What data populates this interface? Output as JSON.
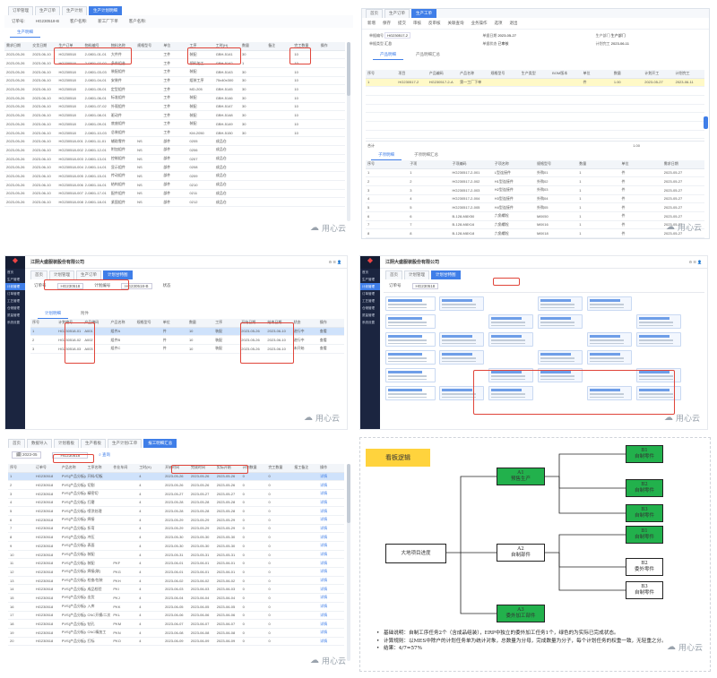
{
  "brand_watermark": "用心云",
  "company_name": "江阴大盛服装股份有限公司",
  "panel1": {
    "tabs": [
      "订单管理",
      "生产订单",
      "生产计划",
      "生产计划明细"
    ],
    "form": {
      "order_label": "订单号:",
      "order_value": "HG230518-B",
      "customer_label": "客户名称:",
      "customer_value": "新工厂下单",
      "product_label": "客户名称:"
    },
    "subtab": "生产明细",
    "columns": [
      "需求日期",
      "交货日期",
      "生产订单",
      "物料编号",
      "物料名称",
      "规格型号",
      "单位",
      "工序",
      "工时(H)",
      "数量",
      "备注",
      "完工数量",
      "操作"
    ],
    "rows": [
      [
        "2023-05-26",
        "2023-06-10",
        "HG230518",
        "2-0801-01-01",
        "大件件",
        "",
        "工件",
        "装配",
        "GBH-5141",
        "30",
        "",
        "10",
        ""
      ],
      [
        "2023-05-26",
        "2023-06-10",
        "HG230518",
        "2-0801-02-02",
        "多件组合",
        "",
        "工件",
        "领料加工",
        "GBH-5142",
        "1",
        "",
        "10",
        ""
      ],
      [
        "2023-05-26",
        "2023-06-10",
        "HG230518",
        "2-0801-03-03",
        "装配组件",
        "",
        "工件",
        "装配",
        "GBH-5143",
        "30",
        "",
        "10",
        ""
      ],
      [
        "2023-05-26",
        "2023-06-10",
        "HG230518",
        "2-0801-04-01",
        "安装件",
        "",
        "工件",
        "组装工序",
        "75x40x300",
        "30",
        "",
        "10",
        ""
      ],
      [
        "2023-05-26",
        "2023-06-10",
        "HG230518",
        "2-0801-05-01",
        "定型组件",
        "",
        "工件",
        "MD-205",
        "GBH-5145",
        "30",
        "",
        "10",
        ""
      ],
      [
        "2023-05-26",
        "2023-06-10",
        "HG230518",
        "2-0801-06-01",
        "标准组件",
        "",
        "工件",
        "装配",
        "GBH-5146",
        "30",
        "",
        "10",
        ""
      ],
      [
        "2023-05-26",
        "2023-06-10",
        "HG230518",
        "2-0801-07-02",
        "外观组件",
        "",
        "工件",
        "装配",
        "GBH-5147",
        "30",
        "",
        "10",
        ""
      ],
      [
        "2023-05-26",
        "2023-06-10",
        "HG230518",
        "2-0801-08-01",
        "驱动件",
        "",
        "工件",
        "装配",
        "GBH-5148",
        "30",
        "",
        "10",
        ""
      ],
      [
        "2023-05-26",
        "2023-06-10",
        "HG230518",
        "2-0801-09-01",
        "底座组件",
        "",
        "工件",
        "装配",
        "GBH-5149",
        "30",
        "",
        "10",
        ""
      ],
      [
        "2023-05-26",
        "2023-06-10",
        "HG230518",
        "2-0801-10-03",
        "总装组件",
        "",
        "工件",
        "KM-2050",
        "GBH-5150",
        "30",
        "",
        "10",
        ""
      ],
      [
        "2023-05-26",
        "2023-06-10",
        "HG230518-001",
        "2-0801-11-01",
        "辅助零件",
        "NS",
        "部件",
        "0205",
        "成品仓",
        "",
        "",
        "",
        ""
      ],
      [
        "2023-05-26",
        "2023-06-10",
        "HG230518-002",
        "2-0801-12-01",
        "附加组件",
        "NS",
        "部件",
        "0206",
        "成品仓",
        "",
        "",
        "",
        ""
      ],
      [
        "2023-05-26",
        "2023-06-10",
        "HG230518-003",
        "2-0801-13-01",
        "控制组件",
        "NS",
        "部件",
        "0207",
        "成品仓",
        "",
        "",
        "",
        ""
      ],
      [
        "2023-05-26",
        "2023-06-10",
        "HG230518-004",
        "2-0801-14-01",
        "显示组件",
        "NS",
        "部件",
        "0208",
        "成品仓",
        "",
        "",
        "",
        ""
      ],
      [
        "2023-05-26",
        "2023-06-10",
        "HG230518-005",
        "2-0801-15-01",
        "传动组件",
        "NS",
        "部件",
        "0209",
        "成品仓",
        "",
        "",
        "",
        ""
      ],
      [
        "2023-05-26",
        "2023-06-10",
        "HG230518-006",
        "2-0801-16-01",
        "结构组件",
        "NS",
        "部件",
        "0210",
        "成品仓",
        "",
        "",
        "",
        ""
      ],
      [
        "2023-05-26",
        "2023-06-10",
        "HG230518-007",
        "2-0801-17-01",
        "配件组件",
        "NS",
        "部件",
        "0211",
        "成品仓",
        "",
        "",
        "",
        ""
      ],
      [
        "2023-05-26",
        "2023-06-10",
        "HG230518-008",
        "2-0801-18-01",
        "紧固组件",
        "NS",
        "部件",
        "0212",
        "成品仓",
        "",
        "",
        "",
        ""
      ]
    ]
  },
  "panel2": {
    "menu": [
      "新增",
      "保存",
      "提交",
      "审核",
      "反审核",
      "关联查询",
      "业务操作",
      "选项",
      "退出"
    ],
    "tabs": [
      "首页",
      "生产订单",
      "生产工单"
    ],
    "form": {
      "no_label": "单据编号",
      "no_value": "HG230517-2",
      "date_label": "单据日期",
      "date_value": "2023-05-27",
      "type_label": "单据类型",
      "type_value": "汇总",
      "dept_label": "生产部门",
      "dept_value": "生产部门",
      "status_label": "单据状态",
      "status_value": "已审核",
      "finish_label": "计划完工",
      "finish_value": "2023-06-11"
    },
    "subtabs": [
      "产品明细",
      "产品明细汇总"
    ],
    "columns": [
      "序号",
      "项目",
      "产品编码",
      "产品名称",
      "规格型号",
      "生产类型",
      "BOM版本",
      "单位",
      "数量",
      "计划开工",
      "计划完工"
    ],
    "hl_row": [
      "1",
      "HG230517-2",
      "HG230517-2-A",
      "第一工厂下单",
      "",
      "",
      "",
      "件",
      "1.00",
      "2023-05-27",
      "2023-06-11"
    ],
    "total_label": "合计",
    "total_value": "1.00",
    "lower_tabs": [
      "子项明细",
      "子项明细汇总"
    ],
    "lower_columns": [
      "序号",
      "子项",
      "子项编码",
      "子项名称",
      "规格型号",
      "数量",
      "单位",
      "需求日期"
    ],
    "lower_rows": [
      [
        "1",
        "1",
        "HG230517-2-001",
        "L型连接件",
        "外购01",
        "1",
        "件",
        "2023-05-27"
      ],
      [
        "2",
        "2",
        "HG230517-2-002",
        "H1型连接件",
        "外购02",
        "1",
        "件",
        "2023-05-27"
      ],
      [
        "3",
        "3",
        "HG230517-2-003",
        "H2型连接件",
        "外购03",
        "1",
        "件",
        "2023-05-27"
      ],
      [
        "4",
        "4",
        "HG230517-2-004",
        "H3型连接件",
        "外购04",
        "1",
        "件",
        "2023-05-27"
      ],
      [
        "5",
        "5",
        "HG230517-2-005",
        "H4型连接件",
        "外购05",
        "1",
        "件",
        "2023-05-27"
      ],
      [
        "6",
        "6",
        "B-128-M8X50",
        "六角螺栓",
        "M8X50",
        "1",
        "件",
        "2023-05-27"
      ],
      [
        "7",
        "7",
        "B-128-M8X16",
        "六角螺栓",
        "M8X16",
        "1",
        "件",
        "2023-05-27"
      ],
      [
        "8",
        "8",
        "B-128-M8X18",
        "六角螺栓",
        "M8X18",
        "1",
        "件",
        "2023-05-27"
      ]
    ],
    "footer": "合计"
  },
  "panel3": {
    "sidebar": [
      "首页",
      "生产管理",
      "计划管理",
      "订单管理",
      "工艺管理",
      "仓储管理",
      "质量管理",
      "系统设置"
    ],
    "tabs": [
      "首页",
      "计划管理",
      "生产订单",
      "计划甘特图"
    ],
    "form": {
      "order_label": "订单号",
      "order_value": "HG230518",
      "plan_label": "计划编号",
      "plan_value": "HG230518-B",
      "status_label": "状态"
    },
    "subtabs": [
      "计划明细",
      "附件"
    ],
    "columns": [
      "序号",
      "计划编号",
      "产品编码",
      "产品名称",
      "规格型号",
      "单位",
      "数量",
      "工序",
      "开始日期",
      "结束日期",
      "状态",
      "操作"
    ],
    "rows": [
      [
        "1",
        "HG230518-01",
        "A001",
        "组件A",
        "",
        "件",
        "10",
        "装配",
        "2023-05-26",
        "2023-06-10",
        "进行中",
        "查看"
      ],
      [
        "2",
        "HG230518-02",
        "A002",
        "组件B",
        "",
        "件",
        "10",
        "装配",
        "2023-05-26",
        "2023-06-10",
        "进行中",
        "查看"
      ],
      [
        "3",
        "HG230518-03",
        "A003",
        "组件C",
        "",
        "件",
        "10",
        "装配",
        "2023-05-26",
        "2023-06-10",
        "未开始",
        "查看"
      ]
    ]
  },
  "panel4": {
    "tabs": [
      "首页",
      "计划管理",
      "计划甘特图"
    ],
    "filter_label": "订单号",
    "filter_value": "HG230518"
  },
  "panel5": {
    "tabs": [
      "首页",
      "数据导入",
      "计划看板",
      "生产看板",
      "生产计划/工单",
      "报工明细汇总"
    ],
    "filter_month": "2023-05",
    "filter_order": "HG230518",
    "search_label": "查询",
    "columns": [
      "序号",
      "订单号",
      "产品名称",
      "工序名称",
      "作业车间",
      "工时(H)",
      "开始时间",
      "完成时间",
      "实际开始",
      "计划数量",
      "完工数量",
      "报工备注",
      "操作"
    ],
    "rows": [
      [
        "1",
        "HG230518",
        "PVS(产品分板)(加工制作)",
        "开料/切板",
        "",
        "4",
        "2023-05-26",
        "2023-05-26",
        "2023-05-26",
        "0",
        "0",
        "",
        "详情"
      ],
      [
        "2",
        "HG230518",
        "PVS(产品分板)(加工制作)",
        "切割",
        "",
        "4",
        "2023-05-26",
        "2023-05-26",
        "2023-05-26",
        "0",
        "0",
        "",
        "详情"
      ],
      [
        "3",
        "HG230518",
        "PVS(产品分板)(加工制作)",
        "精密切",
        "",
        "4",
        "2023-05-27",
        "2023-05-27",
        "2023-05-27",
        "0",
        "0",
        "",
        "详情"
      ],
      [
        "4",
        "HG230518",
        "PVS(产品分板)(加工制作)",
        "打磨",
        "",
        "4",
        "2023-05-28",
        "2023-05-28",
        "2023-05-28",
        "0",
        "0",
        "",
        "详情"
      ],
      [
        "5",
        "HG230518",
        "PVS(产品分板)(加工制作)",
        "喷涂处理",
        "",
        "4",
        "2023-05-28",
        "2023-05-28",
        "2023-05-28",
        "0",
        "0",
        "",
        "详情"
      ],
      [
        "6",
        "HG230518",
        "PVS(产品分板)(加工制作)",
        "焊接",
        "",
        "4",
        "2023-05-29",
        "2023-05-29",
        "2023-05-29",
        "0",
        "0",
        "",
        "详情"
      ],
      [
        "7",
        "HG230518",
        "PVS(产品分板)(加工制作)",
        "折弯",
        "",
        "4",
        "2023-05-29",
        "2023-05-29",
        "2023-05-29",
        "0",
        "0",
        "",
        "详情"
      ],
      [
        "8",
        "HG230518",
        "PVS(产品分板)(加工制作)",
        "冲压",
        "",
        "4",
        "2023-05-30",
        "2023-05-30",
        "2023-05-30",
        "0",
        "0",
        "",
        "详情"
      ],
      [
        "9",
        "HG230518",
        "PVS(产品分板)(加工制作)",
        "表面",
        "",
        "4",
        "2023-05-30",
        "2023-05-30",
        "2023-05-30",
        "0",
        "0",
        "",
        "详情"
      ],
      [
        "10",
        "HG230518",
        "PVS(产品分板)(加工制作)",
        "装配",
        "",
        "4",
        "2023-05-31",
        "2023-05-31",
        "2023-05-31",
        "0",
        "0",
        "",
        "详情"
      ],
      [
        "11",
        "HG230518",
        "PVS(产品分板)(加工制作)",
        "装配",
        "PKF",
        "4",
        "2023-06-01",
        "2023-06-01",
        "2023-06-01",
        "0",
        "0",
        "",
        "详情"
      ],
      [
        "12",
        "HG230518",
        "PVS(产品分板)(加工制作)",
        "焊接(联)",
        "PKG",
        "4",
        "2023-06-01",
        "2023-06-01",
        "2023-06-01",
        "0",
        "0",
        "",
        "详情"
      ],
      [
        "13",
        "HG230518",
        "PVS(产品分板)(加工制作)",
        "检查/包装",
        "PKH",
        "4",
        "2023-06-02",
        "2023-06-02",
        "2023-06-02",
        "0",
        "0",
        "",
        "详情"
      ],
      [
        "14",
        "HG230518",
        "PVS(产品分板)(加工制作)",
        "成品检验",
        "PKI",
        "4",
        "2023-06-03",
        "2023-06-03",
        "2023-06-03",
        "0",
        "0",
        "",
        "详情"
      ],
      [
        "15",
        "HG230518",
        "PVS(产品分板)(加工制作)",
        "出货",
        "PKJ",
        "4",
        "2023-06-04",
        "2023-06-04",
        "2023-06-04",
        "0",
        "0",
        "",
        "详情"
      ],
      [
        "16",
        "HG230518",
        "PVS(产品分板)(加工制作)",
        "入库",
        "PKK",
        "4",
        "2023-06-05",
        "2023-06-05",
        "2023-06-05",
        "0",
        "0",
        "",
        "详情"
      ],
      [
        "17",
        "HG230518",
        "PVS(产品分板)(加工制作)",
        "CNC开模/二次",
        "PKL",
        "4",
        "2023-06-06",
        "2023-06-06",
        "2023-06-06",
        "0",
        "0",
        "",
        "详情"
      ],
      [
        "18",
        "HG230518",
        "PVS(产品分板)(加工制作)",
        "钻孔",
        "PKM",
        "4",
        "2023-06-07",
        "2023-06-07",
        "2023-06-07",
        "0",
        "0",
        "",
        "详情"
      ],
      [
        "19",
        "HG230518",
        "PVS(产品分板)(加工制作)",
        "CNC精加工",
        "PKN",
        "4",
        "2023-06-08",
        "2023-06-08",
        "2023-06-08",
        "0",
        "0",
        "",
        "详情"
      ],
      [
        "20",
        "HG230518",
        "PVS(产品分板)(加工制作)",
        "打标",
        "PKO",
        "4",
        "2023-06-09",
        "2023-06-09",
        "2023-06-09",
        "0",
        "0",
        "",
        "详情"
      ]
    ]
  },
  "panel6": {
    "title": "看板逻辑",
    "nodes": {
      "root": "大地项目进度",
      "a1": "A1\n预售生产",
      "a2": "A2\n自制部件",
      "a3": "A3\n委外加工部件",
      "b1a": "B1\n自制零件",
      "b2a": "B2\n自制零件",
      "b3a": "B3\n自制零件",
      "b1b": "B1\n自制零件",
      "b2b": "B2\n委外零件",
      "b3b": "B3\n自制零件"
    },
    "notes": [
      "基础说明：自制工序任务2个（含成品组装），ERP中独立的委外加工任务1个，绿色的为实际已完成状态。",
      "计算规则：以MES中除户的计划任务单为统计对象，总数量为分母，完成数量为分子，每个计划任务的权重一致，无轻重之分。",
      "结果：4/7=57%"
    ]
  }
}
